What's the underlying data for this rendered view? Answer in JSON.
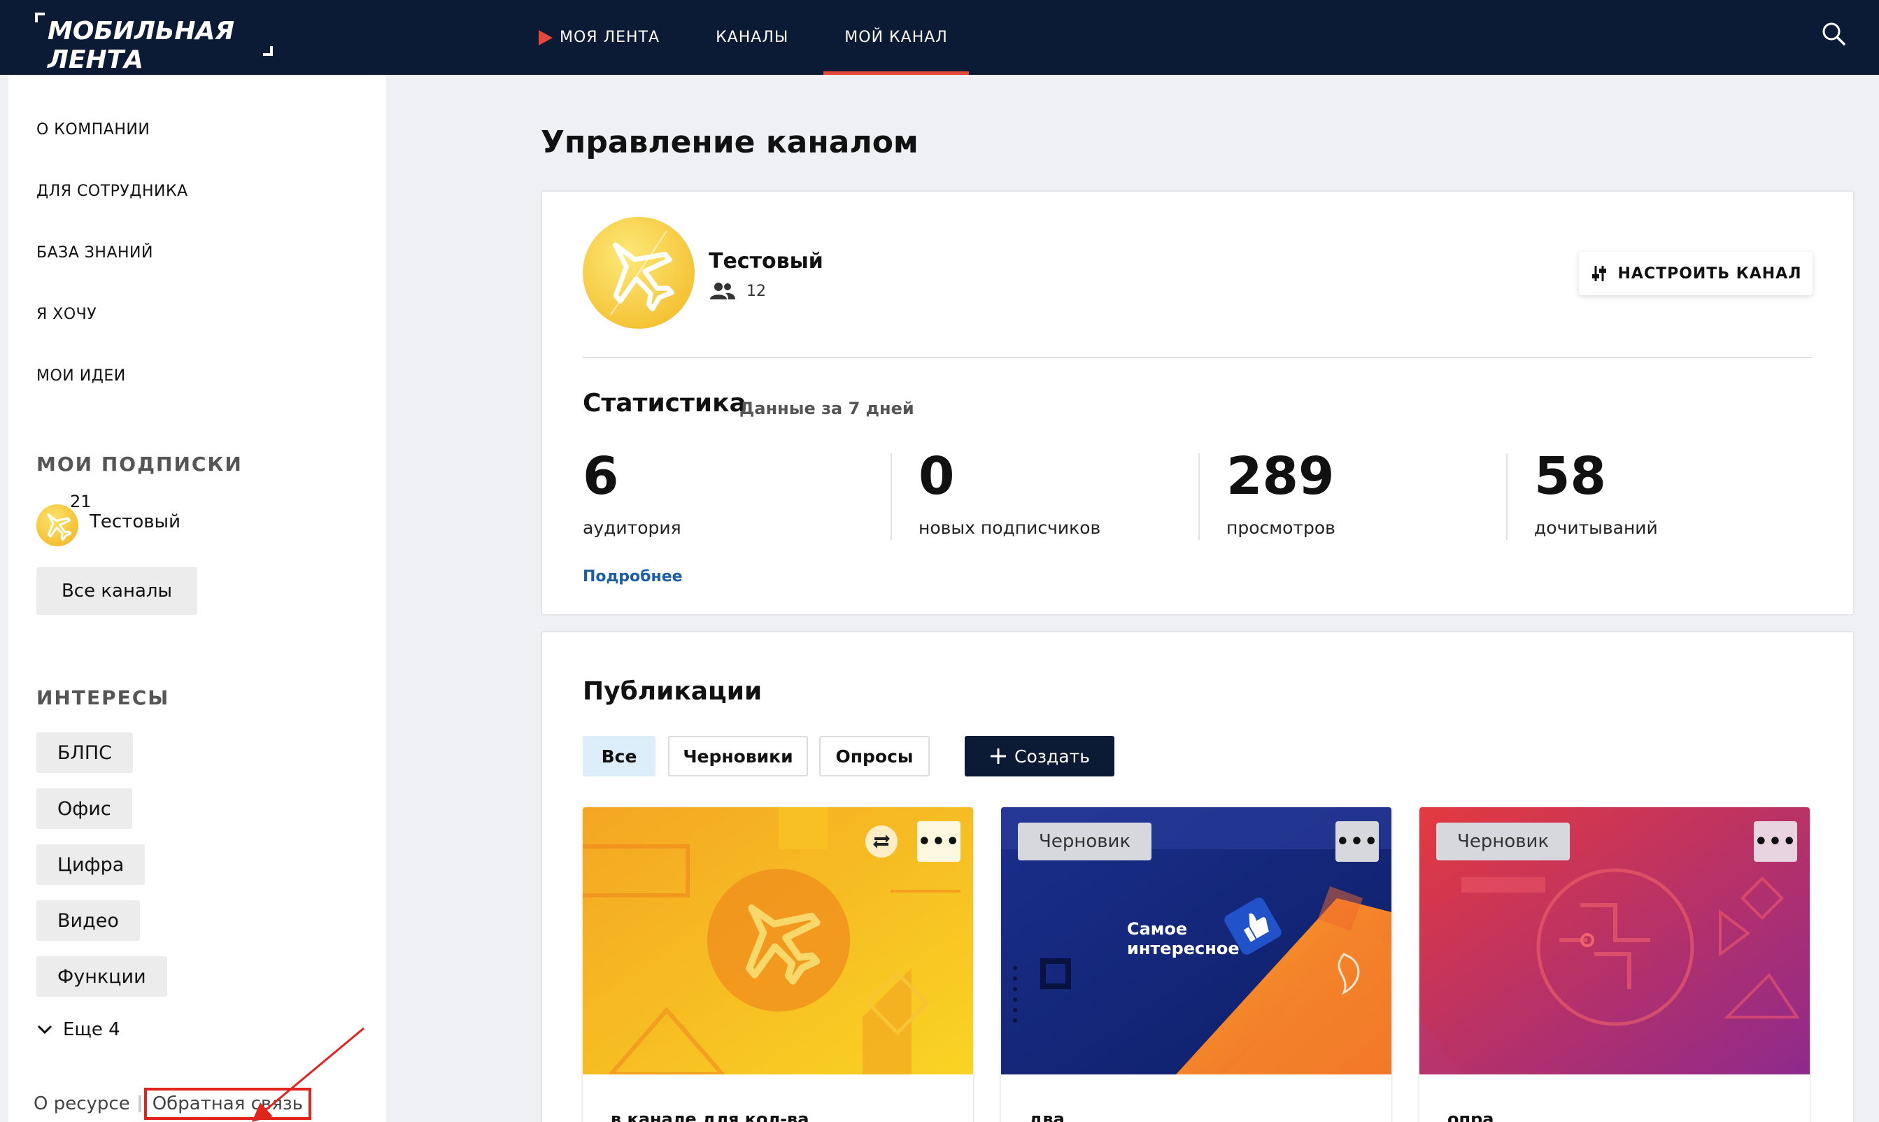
{
  "header": {
    "logo_text": "МОБИЛЬНАЯ ЛЕНТА",
    "nav": [
      {
        "label": "МОЯ ЛЕНТА"
      },
      {
        "label": "КАНАЛЫ"
      },
      {
        "label": "МОЙ КАНАЛ",
        "active": true
      }
    ],
    "icons": {
      "search": "search-icon",
      "feed_marker": "play-icon"
    }
  },
  "sidebar": {
    "links": [
      "О КОМПАНИИ",
      "ДЛЯ СОТРУДНИКА",
      "БАЗА ЗНАНИЙ",
      "Я ХОЧУ",
      "МОИ ИДЕИ"
    ],
    "subscriptions_title": "МОИ ПОДПИСКИ",
    "subscription": {
      "count": "21",
      "name": "Тестовый"
    },
    "all_channels_label": "Все каналы",
    "interests_title": "ИНТЕРЕСЫ",
    "interests": [
      "БЛПС",
      "Офис",
      "Цифра",
      "Видео",
      "Функции"
    ],
    "more_label": "Еще 4",
    "footer": {
      "about": "О ресурсе",
      "feedback": "Обратная связь"
    }
  },
  "main": {
    "title": "Управление каналом",
    "channel": {
      "name": "Тестовый",
      "members": "12",
      "setup_label": "НАСТРОИТЬ КАНАЛ"
    },
    "stats": {
      "title": "Статистика",
      "subtitle": "Данные за 7 дней",
      "items": [
        {
          "value": "6",
          "label": "аудитория"
        },
        {
          "value": "0",
          "label": "новых подписчиков"
        },
        {
          "value": "289",
          "label": "просмотров"
        },
        {
          "value": "58",
          "label": "дочитываний"
        }
      ],
      "more_label": "Подробнее"
    },
    "publications": {
      "title": "Публикации",
      "tabs": [
        "Все",
        "Черновики",
        "Опросы"
      ],
      "create_label": "Создать",
      "posts": [
        {
          "badge": "",
          "caption": "в канале для кол-ва",
          "more": "•••"
        },
        {
          "badge": "Черновик",
          "caption": "два",
          "more": "•••",
          "image_text": "Самое интересное"
        },
        {
          "badge": "Черновик",
          "caption": "опра",
          "more": "•••"
        }
      ]
    }
  },
  "colors": {
    "header_bg": "#0c1b35",
    "accent": "#e5483b",
    "link": "#1b5fa8",
    "annotation": "#e0241e"
  }
}
